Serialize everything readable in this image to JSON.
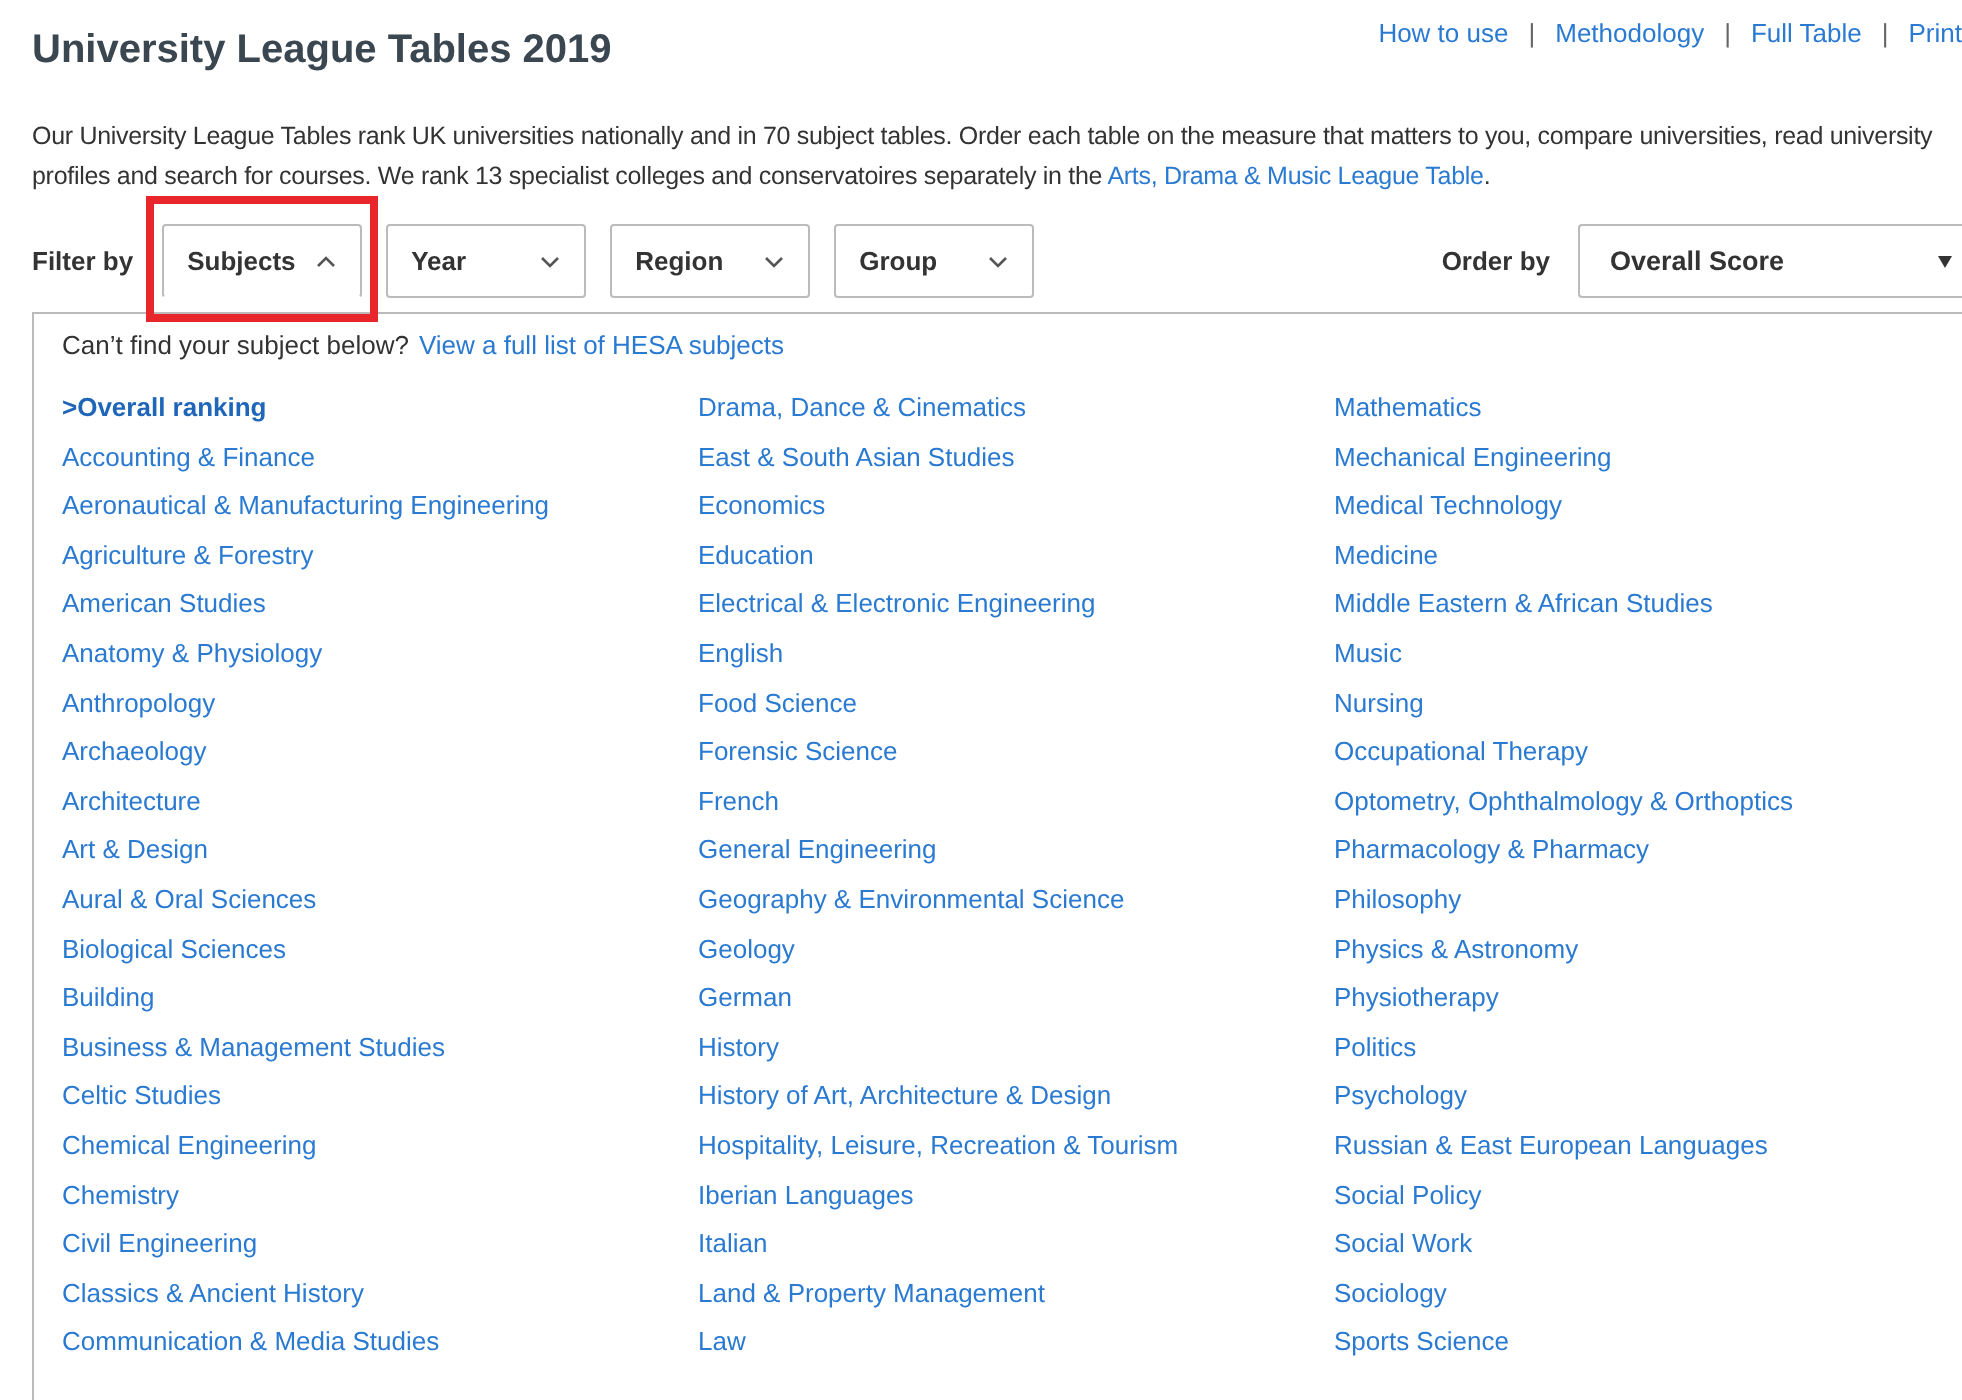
{
  "title": "University League Tables 2019",
  "nav_links": [
    {
      "label": "How to use"
    },
    {
      "label": "Methodology"
    },
    {
      "label": "Full Table"
    },
    {
      "label": "Print"
    }
  ],
  "nav_separators": [
    "|",
    "|",
    "|"
  ],
  "intro": {
    "text": "Our University League Tables rank UK universities nationally and in 70 subject tables. Order each table on the measure that matters to you, compare universities, read university profiles and search for courses. We rank 13 specialist colleges and conservatoires separately in the",
    "link": "Arts, Drama & Music League Table",
    "end": "."
  },
  "filter_label": "Filter by",
  "filters": [
    {
      "label": "Subjects",
      "expanded": true
    },
    {
      "label": "Year",
      "expanded": false
    },
    {
      "label": "Region",
      "expanded": false
    },
    {
      "label": "Group",
      "expanded": false
    }
  ],
  "order_by": {
    "label": "Order by",
    "value": "Overall Score"
  },
  "subject_panel": {
    "hint": "Can’t find your subject below?",
    "hint_link": "View a full list of HESA subjects",
    "selected_marker": ">",
    "columns": [
      [
        {
          "label": "Overall ranking",
          "selected": true
        },
        {
          "label": "Accounting & Finance",
          "selected": false
        },
        {
          "label": "Aeronautical & Manufacturing Engineering",
          "selected": false
        },
        {
          "label": "Agriculture & Forestry",
          "selected": false
        },
        {
          "label": "American Studies",
          "selected": false
        },
        {
          "label": "Anatomy & Physiology",
          "selected": false
        },
        {
          "label": "Anthropology",
          "selected": false
        },
        {
          "label": "Archaeology",
          "selected": false
        },
        {
          "label": "Architecture",
          "selected": false
        },
        {
          "label": "Art & Design",
          "selected": false
        },
        {
          "label": "Aural & Oral Sciences",
          "selected": false
        },
        {
          "label": "Biological Sciences",
          "selected": false
        },
        {
          "label": "Building",
          "selected": false
        },
        {
          "label": "Business & Management Studies",
          "selected": false
        },
        {
          "label": "Celtic Studies",
          "selected": false
        },
        {
          "label": "Chemical Engineering",
          "selected": false
        },
        {
          "label": "Chemistry",
          "selected": false
        },
        {
          "label": "Civil Engineering",
          "selected": false
        },
        {
          "label": "Classics & Ancient History",
          "selected": false
        },
        {
          "label": "Communication & Media Studies",
          "selected": false
        }
      ],
      [
        {
          "label": "Drama, Dance & Cinematics",
          "selected": false
        },
        {
          "label": "East & South Asian Studies",
          "selected": false
        },
        {
          "label": "Economics",
          "selected": false
        },
        {
          "label": "Education",
          "selected": false
        },
        {
          "label": "Electrical & Electronic Engineering",
          "selected": false
        },
        {
          "label": "English",
          "selected": false
        },
        {
          "label": "Food Science",
          "selected": false
        },
        {
          "label": "Forensic Science",
          "selected": false
        },
        {
          "label": "French",
          "selected": false
        },
        {
          "label": "General Engineering",
          "selected": false
        },
        {
          "label": "Geography & Environmental Science",
          "selected": false
        },
        {
          "label": "Geology",
          "selected": false
        },
        {
          "label": "German",
          "selected": false
        },
        {
          "label": "History",
          "selected": false
        },
        {
          "label": "History of Art, Architecture & Design",
          "selected": false
        },
        {
          "label": "Hospitality, Leisure, Recreation & Tourism",
          "selected": false
        },
        {
          "label": "Iberian Languages",
          "selected": false
        },
        {
          "label": "Italian",
          "selected": false
        },
        {
          "label": "Land & Property Management",
          "selected": false
        },
        {
          "label": "Law",
          "selected": false
        }
      ],
      [
        {
          "label": "Mathematics",
          "selected": false
        },
        {
          "label": "Mechanical Engineering",
          "selected": false
        },
        {
          "label": "Medical Technology",
          "selected": false
        },
        {
          "label": "Medicine",
          "selected": false
        },
        {
          "label": "Middle Eastern & African Studies",
          "selected": false
        },
        {
          "label": "Music",
          "selected": false
        },
        {
          "label": "Nursing",
          "selected": false
        },
        {
          "label": "Occupational Therapy",
          "selected": false
        },
        {
          "label": "Optometry, Ophthalmology & Orthoptics",
          "selected": false
        },
        {
          "label": "Pharmacology & Pharmacy",
          "selected": false
        },
        {
          "label": "Philosophy",
          "selected": false
        },
        {
          "label": "Physics & Astronomy",
          "selected": false
        },
        {
          "label": "Physiotherapy",
          "selected": false
        },
        {
          "label": "Politics",
          "selected": false
        },
        {
          "label": "Psychology",
          "selected": false
        },
        {
          "label": "Russian & East European Languages",
          "selected": false
        },
        {
          "label": "Social Policy",
          "selected": false
        },
        {
          "label": "Social Work",
          "selected": false
        },
        {
          "label": "Sociology",
          "selected": false
        },
        {
          "label": "Sports Science",
          "selected": false
        }
      ]
    ]
  }
}
